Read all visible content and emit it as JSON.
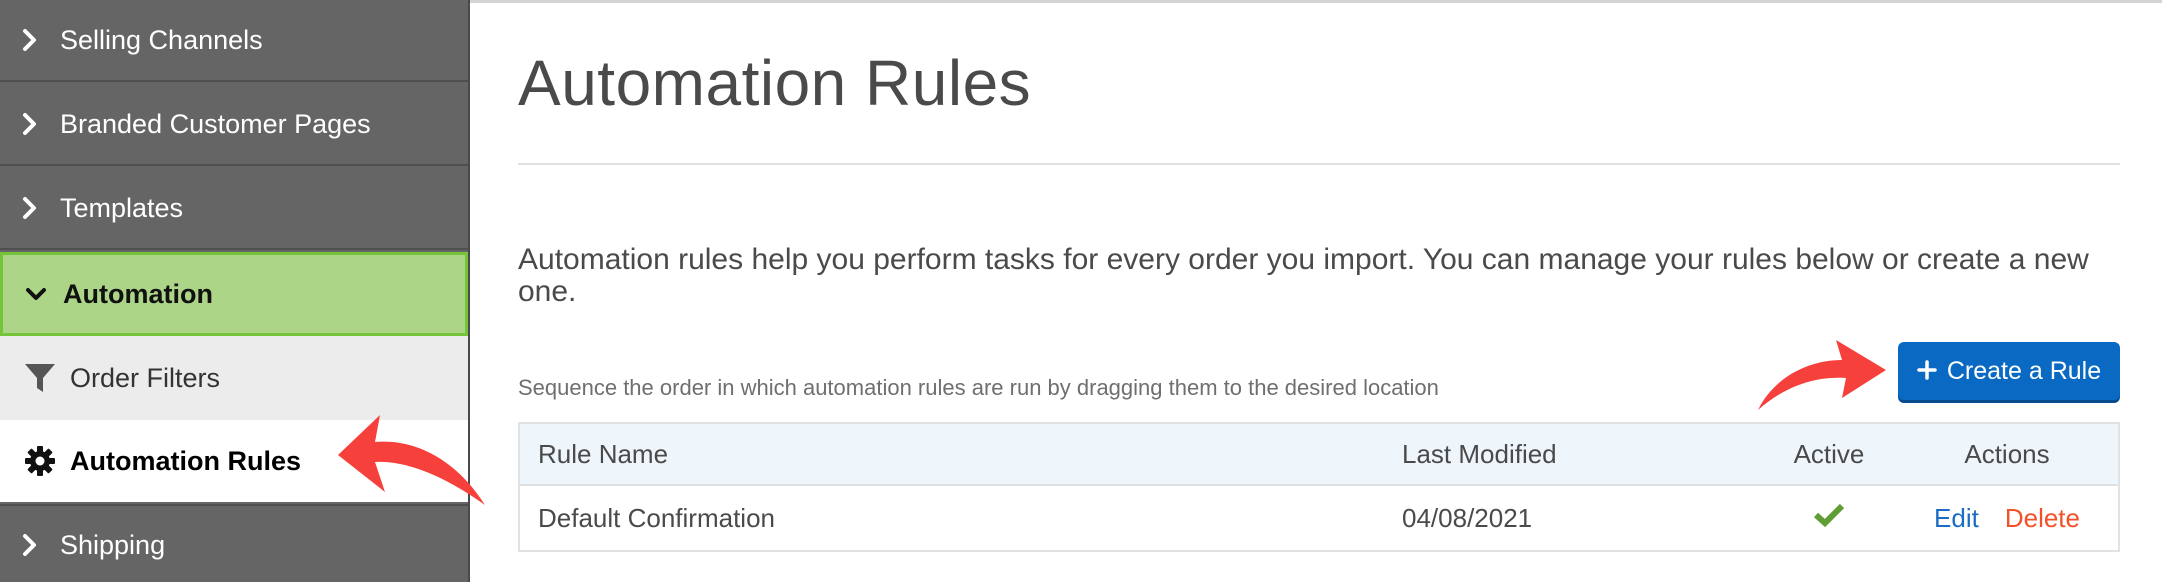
{
  "sidebar": {
    "items": [
      {
        "label": "Selling Channels",
        "icon": "chevron-right-icon",
        "state": "collapsed"
      },
      {
        "label": "Branded Customer Pages",
        "icon": "chevron-right-icon",
        "state": "collapsed"
      },
      {
        "label": "Templates",
        "icon": "chevron-right-icon",
        "state": "collapsed"
      },
      {
        "label": "Automation",
        "icon": "chevron-down-icon",
        "state": "expanded"
      },
      {
        "label": "Order Filters",
        "icon": "filter-icon",
        "state": "sub-item"
      },
      {
        "label": "Automation Rules",
        "icon": "gear-icon",
        "state": "selected"
      },
      {
        "label": "Shipping",
        "icon": "chevron-right-icon",
        "state": "collapsed"
      }
    ]
  },
  "main": {
    "title": "Automation Rules",
    "intro": "Automation rules help you perform tasks for every order you import. You can manage your rules below or create a new one.",
    "hint": "Sequence the order in which automation rules are run by dragging them to the desired location",
    "create_button": {
      "icon": "plus-icon",
      "label": "Create a Rule"
    }
  },
  "table": {
    "columns": [
      "Rule Name",
      "Last Modified",
      "Active",
      "Actions"
    ],
    "rows": [
      {
        "name": "Default Confirmation",
        "last_modified": "04/08/2021",
        "active": true,
        "edit_label": "Edit",
        "delete_label": "Delete"
      }
    ]
  },
  "colors": {
    "sidebar_bg": "#656565",
    "active_parent_bg": "#acd587",
    "active_parent_border": "#76c43a",
    "primary_button": "#0a6ac3",
    "edit_link": "#1a6dc4",
    "delete_link": "#f3512a",
    "active_check": "#5f9e35",
    "annotation_arrow": "#f6403b"
  }
}
